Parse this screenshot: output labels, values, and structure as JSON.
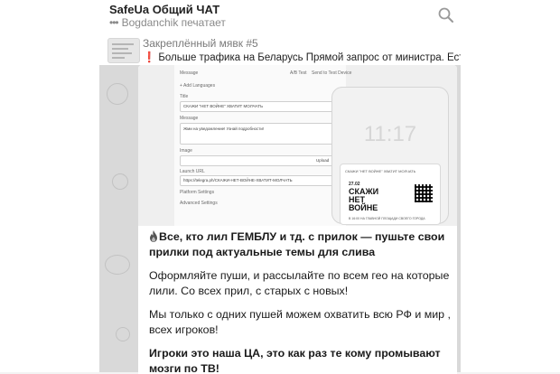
{
  "header": {
    "title": "SafeUa Общий ЧАТ",
    "typing_user": "Bogdanchik печатает",
    "typing_dots": "•••",
    "search_icon": "search-icon"
  },
  "pinned": {
    "title": "Закреплённый мявк #5",
    "exclamation": "❗",
    "text": "Больше трафика на Беларусь  Прямой запрос от министра. Есть з"
  },
  "media": {
    "form_header": "Message",
    "form_link_a": "A/B Test",
    "form_link_b": "Send to Test Device",
    "add_languages": "+ Add Languages",
    "title_label": "Title",
    "title_value": "СКАЖИ \"НЕТ ВОЙНЕ\" ХВАТИТ МОЛЧАТЬ",
    "message_label": "Message",
    "message_value": "Жми на уведомление! Узнай подробности!",
    "image_label": "Image",
    "upload_label": "Upload",
    "launch_label": "Launch URL",
    "launch_value": "https://telegra.ph/СКАЖИ-НЕТ-ВОЙНЕ-ХВАТИТ-МОЛЧАТЬ",
    "platform_settings": "Platform Settings",
    "advanced_settings": "Advanced Settings",
    "phone_time": "11:17",
    "notif_text": "СКАЖИ \"НЕТ ВОЙНЕ\" ХВАТИТ МОЛЧАТЬ",
    "poster_date": "27.02",
    "poster_words": [
      "СКАЖИ",
      "НЕТ",
      "ВОЙНЕ"
    ],
    "poster_note": "В 16:00 НА ГЛАВНОЙ ПЛОЩАДИ СВОЕГО ГОРОДА"
  },
  "message": {
    "para1": "Все, кто лил ГЕМБЛУ и тд. с прилок — пушьте свои прилки под актуальные темы для слива",
    "para2": "Оформляйте пуши, и рассылайте по всем гео на которые лили. Со всех прил, с старых с новых!",
    "para3": "Мы только с одних пушей можем охватить всю РФ и мир , всех игроков!",
    "para4": "Игроки это наша ЦА, это как раз те кому промывают мозги по ТВ!"
  },
  "colors": {
    "header_bg": "#ffffff",
    "chat_bg": "#d9d9d9",
    "text": "#1a1a1a",
    "muted": "#8a8a8a"
  }
}
